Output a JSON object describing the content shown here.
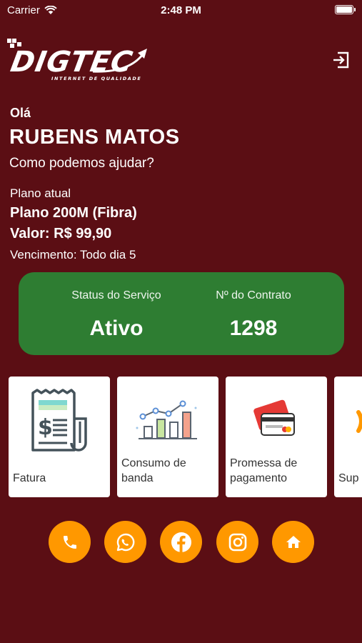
{
  "status_bar": {
    "carrier": "Carrier",
    "time": "2:48 PM",
    "battery_level": 1.0
  },
  "logo": {
    "text": "DIGTEC",
    "tagline": "INTERNET DE QUALIDADE"
  },
  "greeting": "Olá",
  "user_name": "RUBENS MATOS",
  "help_text": "Como podemos ajudar?",
  "plan": {
    "label": "Plano atual",
    "name": "Plano 200M (Fibra)",
    "value": "Valor: R$ 99,90",
    "due": "Vencimento: Todo dia 5"
  },
  "status_card": {
    "status_label": "Status do Serviço",
    "status_value": "Ativo",
    "contract_label": "Nº do Contrato",
    "contract_value": "1298",
    "color": "#2e7d32"
  },
  "tiles": [
    {
      "label": "Fatura",
      "icon": "invoice-icon"
    },
    {
      "label": "Consumo de banda",
      "icon": "bandwidth-chart-icon"
    },
    {
      "label": "Promessa de pagamento",
      "icon": "credit-card-icon"
    },
    {
      "label": "Sup",
      "icon": "support-icon"
    }
  ],
  "social": [
    {
      "icon": "phone-icon"
    },
    {
      "icon": "whatsapp-icon"
    },
    {
      "icon": "facebook-icon"
    },
    {
      "icon": "instagram-icon"
    },
    {
      "icon": "home-icon"
    }
  ],
  "colors": {
    "background": "#5b0e14",
    "accent": "#ff9800",
    "status_green": "#2e7d32"
  }
}
